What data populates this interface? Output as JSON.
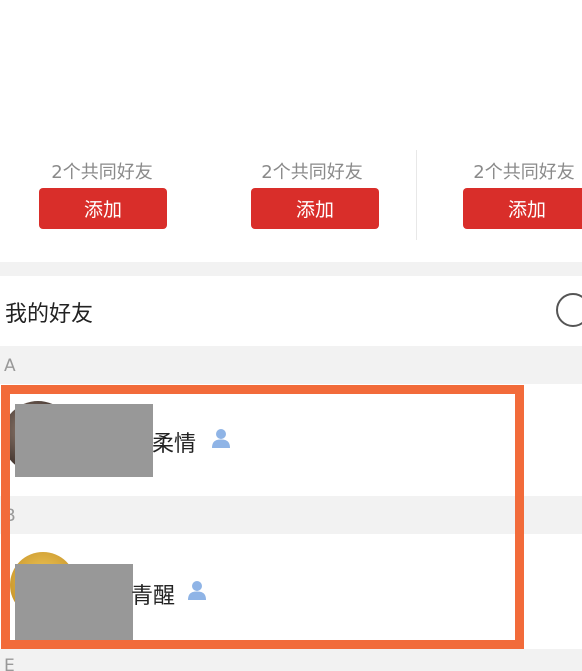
{
  "suggestions": [
    {
      "mutual": "2个共同好友",
      "add_label": "添加"
    },
    {
      "mutual": "2个共同好友",
      "add_label": "添加"
    },
    {
      "mutual": "2个共同好友",
      "add_label": "添加"
    }
  ],
  "friends": {
    "title": "我的好友",
    "header_icon": "circle-icon",
    "sections": [
      {
        "letter": "A",
        "items": [
          {
            "name": "柔情",
            "badge_icon": "person-icon"
          }
        ]
      },
      {
        "letter": "B",
        "items": [
          {
            "name": "青醒",
            "badge_icon": "person-icon"
          }
        ]
      },
      {
        "letter": "E",
        "items": []
      }
    ]
  },
  "colors": {
    "add_button": "#d92e2a",
    "highlight_border": "#f26b3a",
    "badge_icon": "#8fb4e6",
    "section_bg": "#f2f2f2"
  }
}
